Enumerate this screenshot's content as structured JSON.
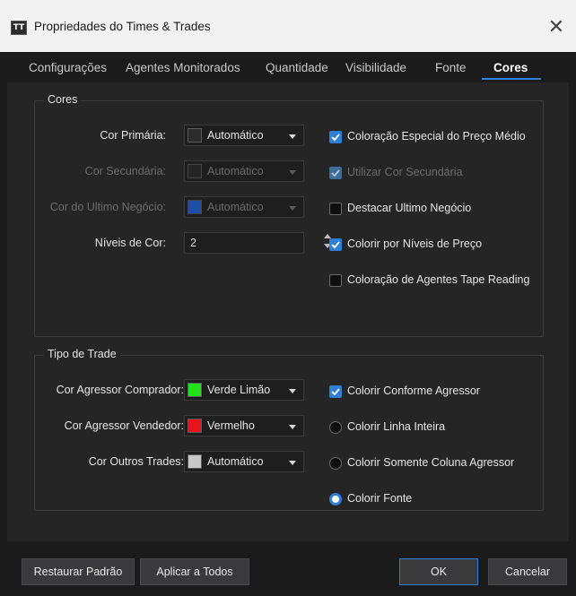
{
  "window": {
    "icon_text": "TT",
    "title": "Propriedades do Times & Trades",
    "close_glyph": "✕"
  },
  "tabs": [
    {
      "label": "Configurações"
    },
    {
      "label": "Agentes Monitorados"
    },
    {
      "label": "Quantidade"
    },
    {
      "label": "Visibilidade"
    },
    {
      "label": "Fonte"
    },
    {
      "label": "Cores",
      "active": true
    }
  ],
  "cores_group": {
    "title": "Cores",
    "primary": {
      "label": "Cor Primária:",
      "value": "Automático",
      "swatch": "#2b2b2b"
    },
    "secondary": {
      "label": "Cor Secundária:",
      "value": "Automático",
      "swatch": "#2b2b2b",
      "disabled": true
    },
    "last_trade": {
      "label": "Cor do Ultimo Negócio:",
      "value": "Automático",
      "swatch": "#1e4fa8",
      "disabled": true
    },
    "levels": {
      "label": "Níveis de Cor:",
      "value": "2"
    },
    "checks": [
      {
        "label": "Coloração Especial do Preço Médio",
        "checked": true
      },
      {
        "label": "Utilizar Cor Secundária",
        "checked": true,
        "disabled": true
      },
      {
        "label": "Destacar Ultimo Negócio",
        "checked": false
      },
      {
        "label": "Colorir por Níveis de Preço",
        "checked": true
      },
      {
        "label": "Coloração de Agentes Tape Reading",
        "checked": false
      }
    ]
  },
  "trade_group": {
    "title": "Tipo de Trade",
    "buyer": {
      "label": "Cor Agressor Comprador:",
      "value": "Verde Limão",
      "swatch": "#22e01a"
    },
    "seller": {
      "label": "Cor Agressor Vendedor:",
      "value": "Vermelho",
      "swatch": "#e8141a"
    },
    "others": {
      "label": "Cor Outros Trades:",
      "value": "Automático",
      "swatch": "#c8c8c8"
    },
    "check_aggressor": {
      "label": "Colorir Conforme Agressor",
      "checked": true
    },
    "radios": [
      {
        "label": "Colorir Linha Inteira",
        "selected": false
      },
      {
        "label": "Colorir Somente Coluna Agressor",
        "selected": false
      },
      {
        "label": "Colorir Fonte",
        "selected": true
      }
    ]
  },
  "footer": {
    "restore_label": "Restaurar Padrão",
    "apply_all_label": "Aplicar a Todos",
    "ok_label": "OK",
    "cancel_label": "Cancelar"
  },
  "colors": {
    "accent": "#2f7fd6",
    "background": "#252526",
    "titlebar": "#f2f2f2"
  }
}
